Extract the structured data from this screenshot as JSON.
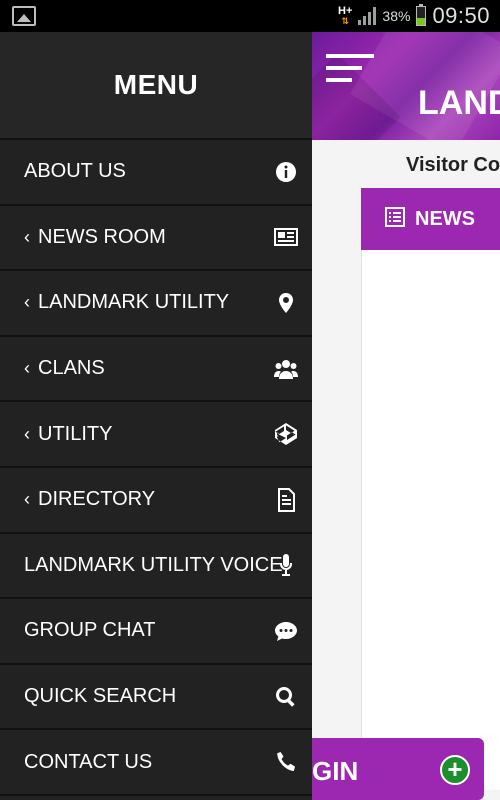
{
  "status_bar": {
    "network": "H+",
    "battery_percent": "38%",
    "battery_level": 0.38,
    "time": "09:50"
  },
  "app": {
    "title": "LAND",
    "visitor_text": "Visitor Co",
    "news_tab_label": "NEWS",
    "login_label": "GIN",
    "accent_color": "#9c27b0"
  },
  "drawer": {
    "title": "MENU",
    "background_color": "#222222",
    "items": [
      {
        "label": "ABOUT US",
        "submenu": false,
        "icon": "info-icon"
      },
      {
        "label": "NEWS ROOM",
        "submenu": true,
        "icon": "newspaper-icon"
      },
      {
        "label": "LANDMARK UTILITY",
        "submenu": true,
        "icon": "map-marker-icon"
      },
      {
        "label": "CLANS",
        "submenu": true,
        "icon": "users-icon"
      },
      {
        "label": "UTILITY",
        "submenu": true,
        "icon": "codepen-icon"
      },
      {
        "label": "DIRECTORY",
        "submenu": true,
        "icon": "document-icon"
      },
      {
        "label": "LANDMARK UTILITY VOICE",
        "submenu": false,
        "icon": "microphone-icon"
      },
      {
        "label": "GROUP CHAT",
        "submenu": false,
        "icon": "chat-icon"
      },
      {
        "label": "QUICK SEARCH",
        "submenu": false,
        "icon": "search-icon"
      },
      {
        "label": "CONTACT US",
        "submenu": false,
        "icon": "phone-icon"
      }
    ],
    "chevron": "‹"
  }
}
